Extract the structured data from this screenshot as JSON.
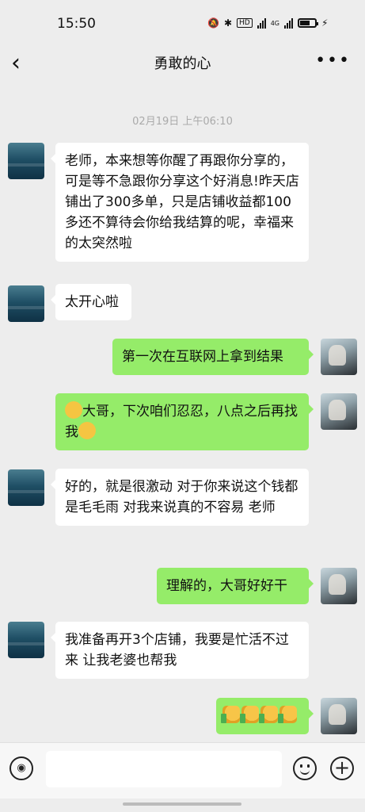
{
  "status_bar": {
    "time": "15:50",
    "hd_badge": "HD",
    "signal1": "4G",
    "signal2": "4G"
  },
  "header": {
    "title": "勇敢的心",
    "back_icon": "chevron-left-icon",
    "more_icon": "more-dots-icon"
  },
  "timestamp": "02月19日 上午06:10",
  "messages": [
    {
      "side": "left",
      "text": "老师，本来想等你醒了再跟你分享的，可是等不急跟你分享这个好消息!昨天店铺出了300多单，只是店铺收益都100多还不算待会你给我结算的呢，幸福来的太突然啦"
    },
    {
      "side": "left",
      "text": "太开心啦"
    },
    {
      "side": "right",
      "text": "第一次在互联网上拿到结果"
    },
    {
      "side": "right",
      "text_before": "大哥，下次咱们忍忍，八点之后再找我",
      "emoji1": "crying-laughing-emoji",
      "emoji2": "thinking-emoji"
    },
    {
      "side": "left",
      "text": "好的，就是很激动 对于你来说这个钱都是毛毛雨 对我来说真的不容易 老师"
    },
    {
      "side": "right",
      "text": "理解的，大哥好好干"
    },
    {
      "side": "left",
      "text": "我准备再开3个店铺，我要是忙活不过来 让我老婆也帮我"
    },
    {
      "side": "right",
      "emoji": "thumbs-up-emoji",
      "count": 4
    }
  ],
  "input_bar": {
    "voice_icon": "voice-icon",
    "emoji_icon": "emoji-icon",
    "plus_icon": "plus-icon"
  }
}
